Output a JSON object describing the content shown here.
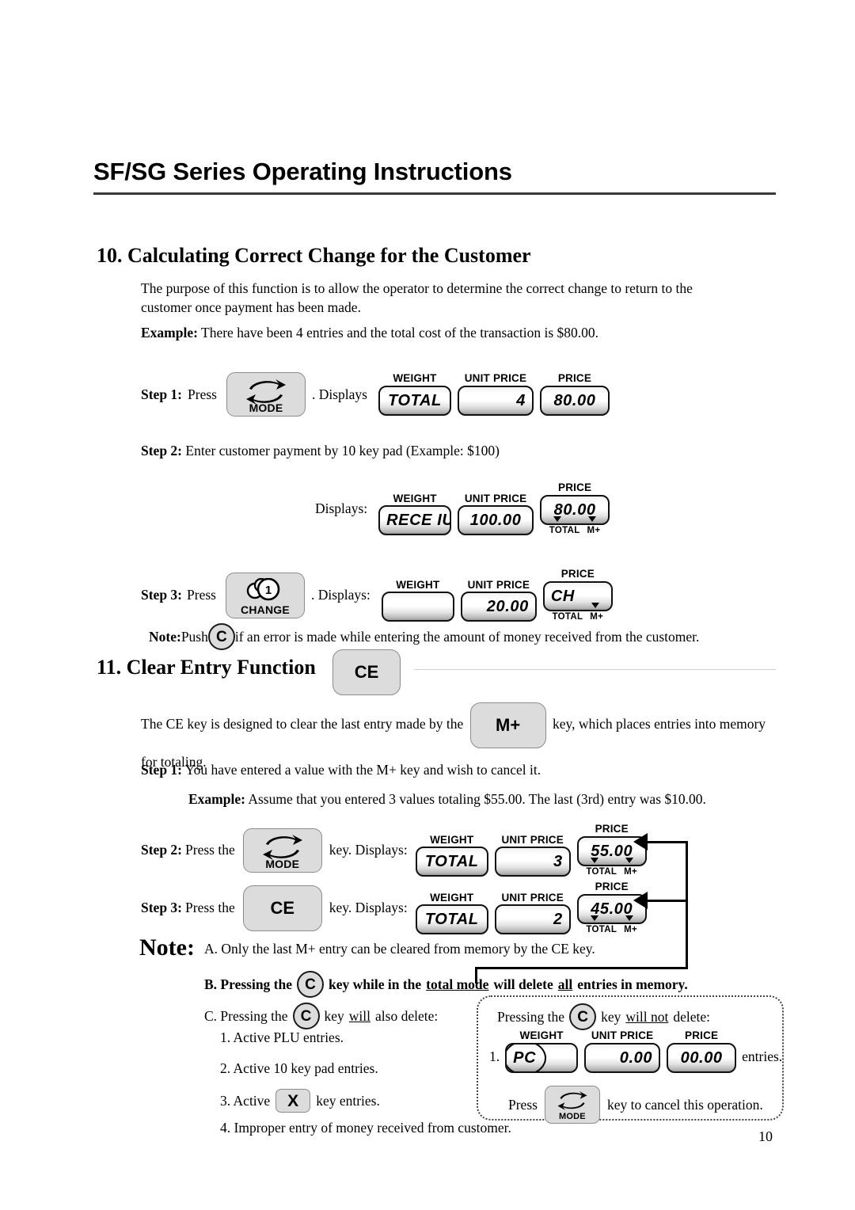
{
  "header": {
    "title": "SF/SG Series Operating Instructions"
  },
  "page_number": "10",
  "section10": {
    "heading": "10. Calculating Correct Change for the Customer",
    "purpose": "The purpose of this function is to allow the operator to determine the correct change to return to the customer once payment has been made.",
    "example_label": "Example:",
    "example_text": " There have been 4 entries and the total cost of the transaction is $80.00.",
    "step1": {
      "label": "Step 1:",
      "press_word": "Press",
      "key": {
        "name": "mode-key",
        "label": "MODE"
      },
      "after": ".  Displays",
      "display": {
        "weight": {
          "caption": "WEIGHT",
          "value": "TOTAL"
        },
        "unit_price": {
          "caption": "UNIT PRICE",
          "value": "4"
        },
        "price": {
          "caption": "PRICE",
          "value": "80.00"
        }
      }
    },
    "step2": {
      "label": "Step 2:",
      "text": " Enter customer payment by 10 key pad (Example: $100)",
      "displays_word": "Displays:",
      "display": {
        "weight": {
          "caption": "WEIGHT",
          "value": "RECE IU"
        },
        "unit_price": {
          "caption": "UNIT PRICE",
          "value": "100.00"
        },
        "price": {
          "caption": "PRICE",
          "value": "80.00",
          "annunciators": [
            "TOTAL",
            "M+"
          ]
        }
      }
    },
    "step3": {
      "label": "Step 3:",
      "press_word": "Press",
      "key": {
        "name": "change-key",
        "label": "CHANGE",
        "coin_digit": "1"
      },
      "after": ". Displays:",
      "display": {
        "weight": {
          "caption": "WEIGHT",
          "value": ""
        },
        "unit_price": {
          "caption": "UNIT PRICE",
          "value": "20.00"
        },
        "price": {
          "caption": "PRICE",
          "value": "CH",
          "annunciators": [
            "TOTAL",
            "M+"
          ]
        }
      }
    },
    "note": {
      "label": "Note:",
      "before": " Push ",
      "key": "C",
      "after": " if an error is made while entering the amount of money received from the customer."
    }
  },
  "section11": {
    "heading": "11. Clear Entry Function",
    "heading_key": {
      "name": "ce-key",
      "label": "CE"
    },
    "desc_part1": "The CE key is designed to clear the last entry made by the ",
    "desc_key": {
      "name": "m-plus-key",
      "label": "M+"
    },
    "desc_part2": " key, which places entries into memory for totaling.",
    "step1": {
      "label": "Step 1:",
      "text": "  You have entered a value with the M+ key and wish to cancel it."
    },
    "example_label": "Example:",
    "example_text": " Assume that you entered 3 values totaling $55.00. The last (3rd) entry was $10.00.",
    "step2": {
      "label": "Step 2:",
      "press_word": " Press the",
      "key": {
        "name": "mode-key",
        "label": "MODE"
      },
      "after": "key.  Displays:",
      "display": {
        "weight": {
          "caption": "WEIGHT",
          "value": "TOTAL"
        },
        "unit_price": {
          "caption": "UNIT PRICE",
          "value": "3"
        },
        "price": {
          "caption": "PRICE",
          "value": "55.00",
          "annunciators": [
            "TOTAL",
            "M+"
          ]
        }
      }
    },
    "step3": {
      "label": "Step 3:",
      "press_word": " Press the",
      "key": {
        "name": "ce-key",
        "label": "CE"
      },
      "after": "key.  Displays:",
      "display": {
        "weight": {
          "caption": "WEIGHT",
          "value": "TOTAL"
        },
        "unit_price": {
          "caption": "UNIT PRICE",
          "value": "2"
        },
        "price": {
          "caption": "PRICE",
          "value": "45.00",
          "annunciators": [
            "TOTAL",
            "M+"
          ]
        }
      }
    }
  },
  "note_block": {
    "word": "Note:",
    "a": "A. Only the last M+ entry can be cleared from memory by the CE key.",
    "b_pre": "B. Pressing the",
    "b_key": "C",
    "b_mid": "key while in the ",
    "b_underline1": "total mode",
    "b_mid2": " will delete ",
    "b_underline2": "all",
    "b_end": " entries in memory.",
    "c_pre": "C. Pressing the",
    "c_key": "C",
    "c_mid": "key ",
    "c_underline": "will",
    "c_end": " also delete:",
    "sub_items": {
      "one": "1. Active PLU entries.",
      "two": "2. Active 10 key pad entries.",
      "three_pre": "3. Active",
      "three_key": "X",
      "three_post": "key entries.",
      "four": "4. Improper entry of money received from customer."
    }
  },
  "dashed_box": {
    "line1_pre": "Pressing the",
    "line1_key": "C",
    "line1_mid": "key ",
    "line1_underline": "will not",
    "line1_end": " delete:",
    "item_number": "1.",
    "display": {
      "weight": {
        "caption": "WEIGHT",
        "value": "PC"
      },
      "unit_price": {
        "caption": "UNIT PRICE",
        "value": "0.00"
      },
      "price": {
        "caption": "PRICE",
        "value": "00.00"
      }
    },
    "tail": "entries.",
    "press_word": "Press",
    "mode_key": {
      "name": "mode-key",
      "label": "MODE"
    },
    "cancel_text": "key to cancel this operation."
  }
}
